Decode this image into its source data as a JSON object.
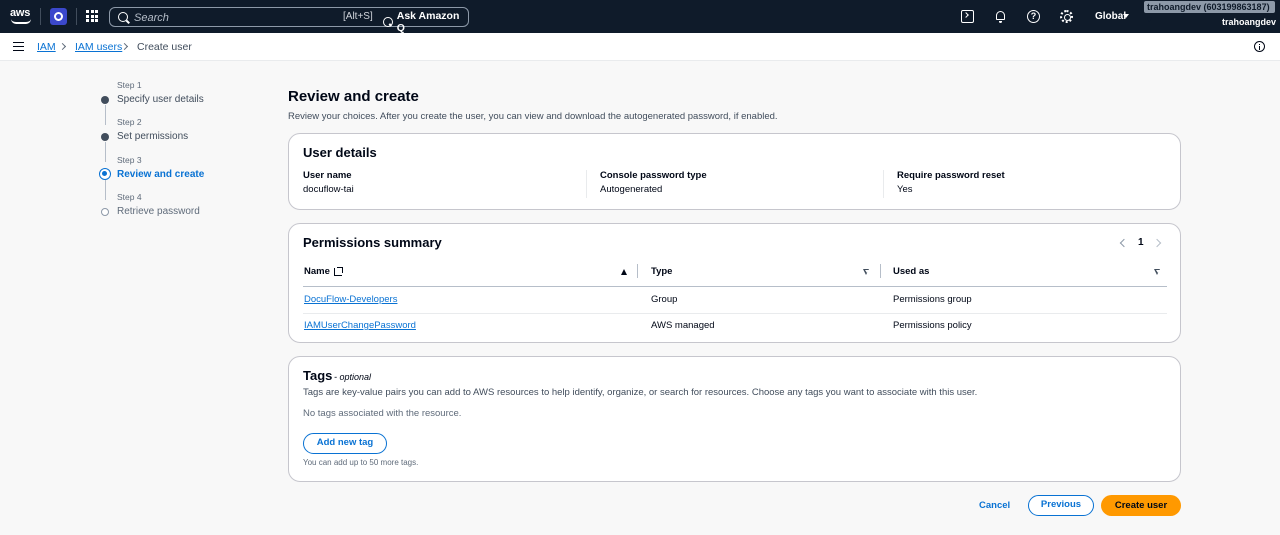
{
  "topnav": {
    "logo_text": "aws",
    "search_placeholder": "Search",
    "search_shortcut": "[Alt+S]",
    "ask_q_label": "Ask Amazon Q",
    "region_label": "Global",
    "account_chip": "trahoangdev (603199863187) ▾",
    "account_user": "trahoangdev",
    "icons": [
      "aws-logo",
      "service-icon",
      "apps-grid-icon",
      "search-icon",
      "amazon-q-icon",
      "cloudshell-icon",
      "bell-icon",
      "help-icon",
      "gear-icon"
    ]
  },
  "breadcrumb": {
    "items": [
      {
        "label": "IAM"
      },
      {
        "label": "IAM users"
      },
      {
        "label": "Create user"
      }
    ]
  },
  "steps": [
    {
      "number": "Step 1",
      "title": "Specify user details",
      "state": "completed"
    },
    {
      "number": "Step 2",
      "title": "Set permissions",
      "state": "completed"
    },
    {
      "number": "Step 3",
      "title": "Review and create",
      "state": "active"
    },
    {
      "number": "Step 4",
      "title": "Retrieve password",
      "state": "upcoming"
    }
  ],
  "page": {
    "title": "Review and create",
    "description": "Review your choices. After you create the user, you can view and download the autogenerated password, if enabled."
  },
  "user_details": {
    "title": "User details",
    "fields": [
      {
        "label": "User name",
        "value": "docuflow-tai"
      },
      {
        "label": "Console password type",
        "value": "Autogenerated"
      },
      {
        "label": "Require password reset",
        "value": "Yes"
      }
    ]
  },
  "permissions_summary": {
    "title": "Permissions summary",
    "page": "1",
    "columns": [
      "Name",
      "Type",
      "Used as"
    ],
    "rows": [
      {
        "name": "DocuFlow-Developers",
        "type": "Group",
        "used_as": "Permissions group"
      },
      {
        "name": "IAMUserChangePassword",
        "type": "AWS managed",
        "used_as": "Permissions policy"
      }
    ]
  },
  "tags": {
    "title": "Tags",
    "optional": "- optional",
    "description": "Tags are key-value pairs you can add to AWS resources to help identify, organize, or search for resources. Choose any tags you want to associate with this user.",
    "empty_text": "No tags associated with the resource.",
    "add_button": "Add new tag",
    "hint": "You can add up to 50 more tags."
  },
  "footer": {
    "cancel": "Cancel",
    "previous": "Previous",
    "create": "Create user"
  },
  "colors": {
    "nav_bg": "#0f1b2a",
    "link": "#0972d3",
    "primary_button": "#ff9900"
  }
}
